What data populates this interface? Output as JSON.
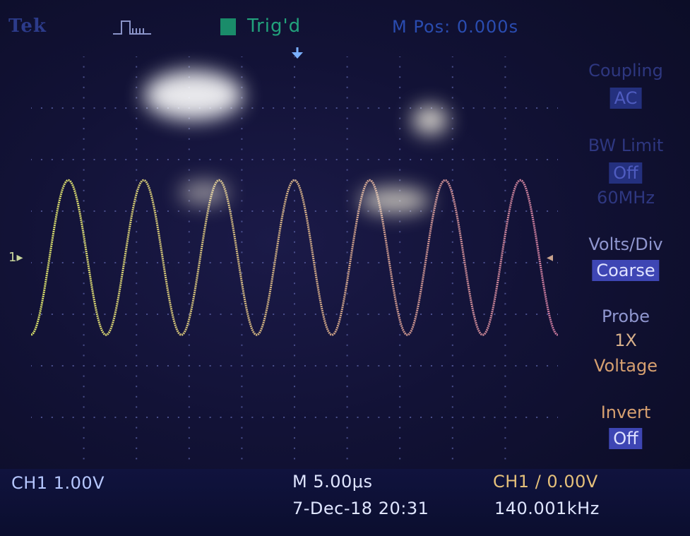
{
  "header": {
    "brand": "Tek",
    "trigger_status": "Trig'd",
    "m_pos": "M Pos: 0.000s"
  },
  "side_menu": {
    "coupling_label": "Coupling",
    "coupling_value": "AC",
    "bw_limit_label": "BW Limit",
    "bw_limit_value": "Off",
    "bw_limit_freq": "60MHz",
    "volts_div_label": "Volts/Div",
    "volts_div_value": "Coarse",
    "probe_label": "Probe",
    "probe_value": "1X",
    "probe_type": "Voltage",
    "invert_label": "Invert",
    "invert_value": "Off"
  },
  "status_bar": {
    "ch1_scale": "CH1  1.00V",
    "timebase": "M 5.00μs",
    "trigger": "CH1 ∕ 0.00V",
    "datetime": "7-Dec-18 20:31",
    "frequency": "140.001kHz"
  },
  "markers": {
    "ch1": "1▸",
    "trigger_level": "◂"
  },
  "waveform": {
    "channel": "CH1",
    "amplitude_div": 1.5,
    "offset_div": 0.1,
    "period_div": 1.43,
    "phase_div": 0.35
  },
  "colors": {
    "trace_start": "#d7e06a",
    "trace_end": "#c8789e",
    "grid_dots": "#4a4f8c",
    "menu_label": "#9aa0d8",
    "menu_value_orange": "#e0a070"
  }
}
